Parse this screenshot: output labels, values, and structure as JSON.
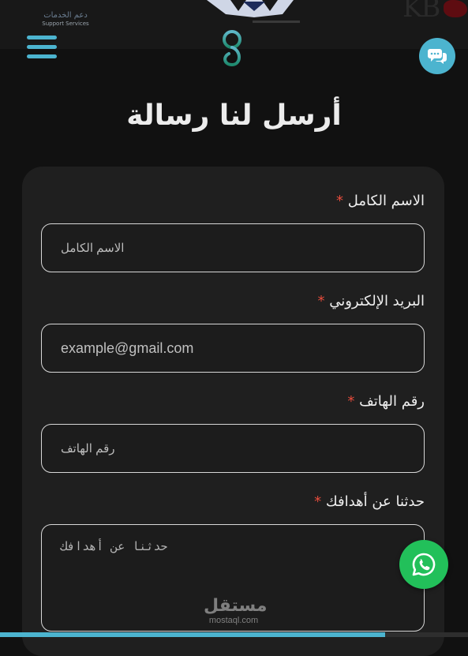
{
  "header": {
    "partners": {
      "support": {
        "arabic": "دعم الخدمات",
        "english": "Support Services"
      },
      "kb": "KB"
    }
  },
  "page": {
    "title": "أرسل لنا رسالة"
  },
  "form": {
    "required_marker": "*",
    "fields": [
      {
        "label": "الاسم الكامل",
        "placeholder": "الاسم الكامل",
        "value": ""
      },
      {
        "label": "البريد الإلكتروني",
        "placeholder": "example@gmail.com",
        "value": ""
      },
      {
        "label": "رقم الهاتف",
        "placeholder": "رقم الهاتف",
        "value": ""
      },
      {
        "label": "حدثنا عن أهدافك",
        "placeholder": "حدثنا عن أهدافك",
        "value": ""
      }
    ]
  },
  "watermark": {
    "arabic": "مستقل",
    "english": "mostaql.com"
  },
  "colors": {
    "accent": "#4cb4cf",
    "whatsapp": "#22c05a",
    "required": "#e74c3c",
    "background": "#111111",
    "card": "#1f1f1f"
  },
  "icons": {
    "menu": "hamburger-icon",
    "chat": "chat-bubbles-icon",
    "whatsapp": "whatsapp-icon"
  }
}
